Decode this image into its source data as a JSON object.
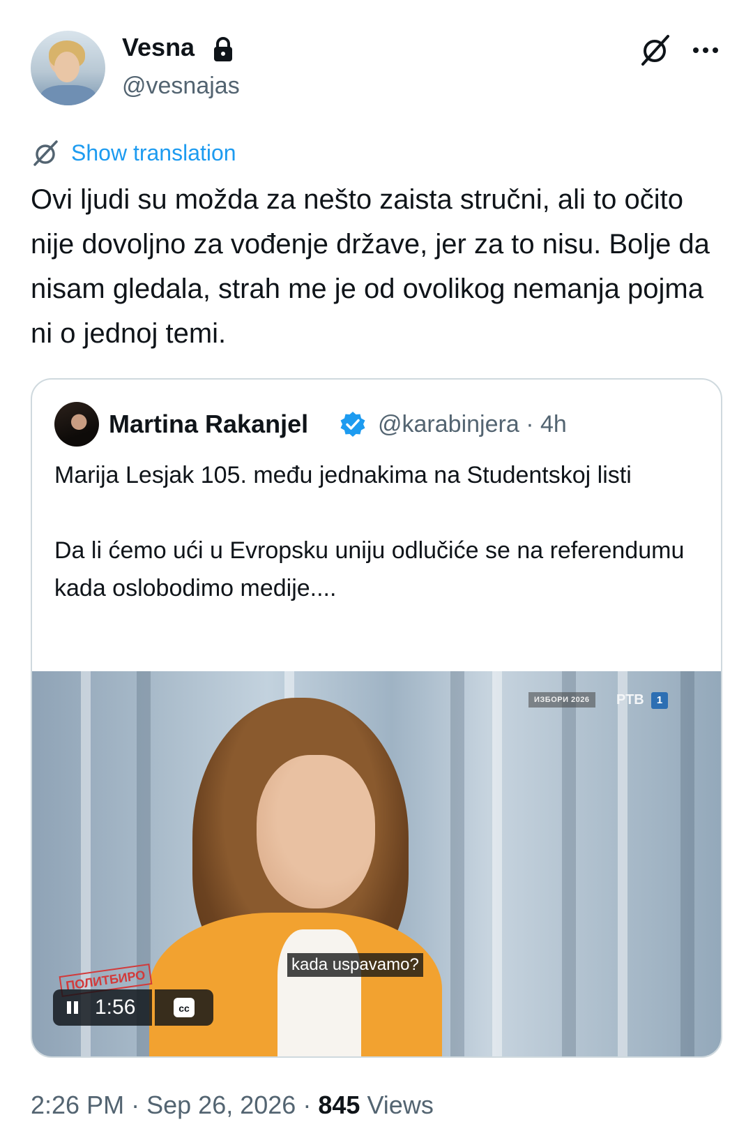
{
  "author": {
    "display_name": "Vesna",
    "handle": "@vesnajas"
  },
  "translation": {
    "label": "Show translation"
  },
  "tweet": {
    "text": "Ovi ljudi su možda za nešto zaista stručni, ali to očito nije dovoljno za vođenje države, jer za to nisu. Bolje da nisam gledala, strah me je od ovolikog nemanja pojma ni o jednoj temi."
  },
  "quote": {
    "display_name": "Martina Rakanjel",
    "handle": "@karabinjera",
    "separator": "·",
    "time": "4h",
    "text": "Marija Lesjak 105. među jednakima na Studentskoj listi\n\nDa li ćemo ući u Evropsku uniju odlučiće se na referendumu kada oslobodimo medije...."
  },
  "video": {
    "broadcast_badge": "ИЗБОРИ 2026",
    "channel": "РТВ",
    "channel_number": "1",
    "stamp": "ПОЛИТБИРО",
    "subtitle": "kada uspavamo?",
    "duration": "1:56"
  },
  "footer": {
    "time": "2:26 PM",
    "date": "Sep 26, 2026",
    "dot": "·",
    "views_count": "845",
    "views_label": "Views"
  },
  "colors": {
    "accent": "#1d9bf0",
    "secondary_text": "#536471",
    "border": "#cfd9de",
    "jacket": "#f2a230"
  },
  "icons": [
    "lock-icon",
    "grok-icon",
    "more-icon",
    "translate-icon",
    "verified-icon",
    "pause-icon",
    "cc-icon"
  ]
}
